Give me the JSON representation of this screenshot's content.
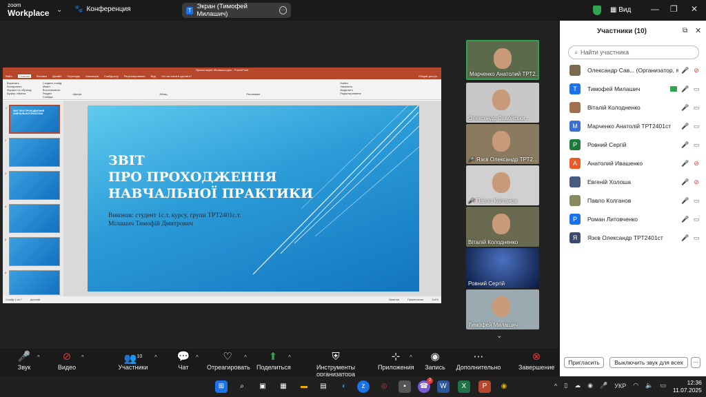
{
  "app": {
    "logo_top": "zoom",
    "logo_bottom": "Workplace",
    "meeting_label": "Конференция",
    "share_label": "Экран (Тимофей Милашич)",
    "view_label": "Вид"
  },
  "ppt": {
    "window_title": "Презентація1 Милашич.pptx - PowerPoint",
    "tabs": [
      "Файл",
      "Главная",
      "Вставка",
      "Дизайн",
      "Переходы",
      "Анимация",
      "Слайд-шоу",
      "Рецензирование",
      "Вид",
      "Что вы хотите сделать?"
    ],
    "share_btn": "Общий доступ",
    "ribbon_groups": [
      "Буфер обмена",
      "Слайды",
      "Шрифт",
      "Абзац",
      "Рисование",
      "Редактирование"
    ],
    "ribbon_items": [
      "Вырезать",
      "Копировать",
      "Формат по образцу",
      "Создать слайд",
      "Макет",
      "Восстановить",
      "Раздел",
      "Найти",
      "Заменить",
      "Выделить"
    ],
    "status_left": "Слайд 1 из 7",
    "status_lang": "русский",
    "status_notes": "Заметки",
    "status_comments": "Примечания",
    "zoom": "114%",
    "slide": {
      "title": "ЗВІТ\nПРО ПРОХОДЖЕННЯ\nНАВЧАЛЬНОЇ ПРАКТИКИ",
      "subtitle_line1": "Виконав: студент 1с.т. курсу, групи ТРТ2401с.т.",
      "subtitle_line2": "Мілашич Тимофій Дмитрович"
    },
    "thumbs": [
      {
        "n": "1",
        "t": "ЗВІТ ПРО ПРОХОДЖЕННЯ НАВЧАЛЬНОЇ ПРАКТИКИ"
      },
      {
        "n": "2",
        "t": ""
      },
      {
        "n": "3",
        "t": ""
      },
      {
        "n": "4",
        "t": ""
      },
      {
        "n": "5",
        "t": ""
      },
      {
        "n": "6",
        "t": ""
      }
    ]
  },
  "videos": [
    {
      "name": "Марченко Анатолий ТРТ2...",
      "muted": false
    },
    {
      "name": "Олександр Савойськи...",
      "muted": false
    },
    {
      "name": "Язєв Олександр ТРТ2...",
      "muted": true
    },
    {
      "name": "Павло Колганов",
      "muted": true
    },
    {
      "name": "Віталій Колодненко",
      "muted": false
    },
    {
      "name": "Ровний Сергій",
      "muted": false
    },
    {
      "name": "Тимофей Милашич",
      "muted": false
    }
  ],
  "panel": {
    "title": "Участники (10)",
    "search_placeholder": "Найти участника",
    "invite": "Пригласить",
    "mute_all": "Выключить звук для всех",
    "more": "···"
  },
  "participants": [
    {
      "name": "Олександр Сав...  (Организатор, я)",
      "initial": "",
      "color": "#7a6a50",
      "mic": "off",
      "cam": "off"
    },
    {
      "name": "Тимофей Милашич",
      "initial": "T",
      "color": "#1a73e8",
      "mic": "on",
      "cam": "on",
      "sharing": true
    },
    {
      "name": "Віталій Колодненко",
      "initial": "",
      "color": "#a07050",
      "mic": "on",
      "cam": "on"
    },
    {
      "name": "Марченко Анатолій ТРТ2401ст",
      "initial": "M",
      "color": "#3a6fd8",
      "mic": "on",
      "cam": "on"
    },
    {
      "name": "Ровний Сергій",
      "initial": "P",
      "color": "#1e7a3c",
      "mic": "on",
      "cam": "on"
    },
    {
      "name": "Анатолий Ивашенко",
      "initial": "A",
      "color": "#e85a2a",
      "mic": "off",
      "cam": "off"
    },
    {
      "name": "Евгенiй Холоша",
      "initial": "",
      "color": "#4a5a80",
      "mic": "off",
      "cam": "off"
    },
    {
      "name": "Павло Колганов",
      "initial": "",
      "color": "#8a8a60",
      "mic": "off",
      "cam": "on"
    },
    {
      "name": "Роман Литовченко",
      "initial": "P",
      "color": "#1a73e8",
      "mic": "off",
      "cam": "on"
    },
    {
      "name": "Язєв Олександр ТРТ2401ст",
      "initial": "Я",
      "color": "#3a4a6a",
      "mic": "off",
      "cam": "on"
    }
  ],
  "toolbar": {
    "audio": "Звук",
    "video": "Видео",
    "participants": "Участники",
    "participants_count": "10",
    "chat": "Чат",
    "react": "Отреагировать",
    "share": "Поделиться",
    "host_tools": "Инструменты организатора",
    "apps": "Приложения",
    "record": "Запись",
    "more": "Дополнительно",
    "end": "Завершение"
  },
  "taskbar": {
    "lang": "УКР",
    "time": "12:36",
    "date": "11.07.2025",
    "viber_badge": "2"
  }
}
